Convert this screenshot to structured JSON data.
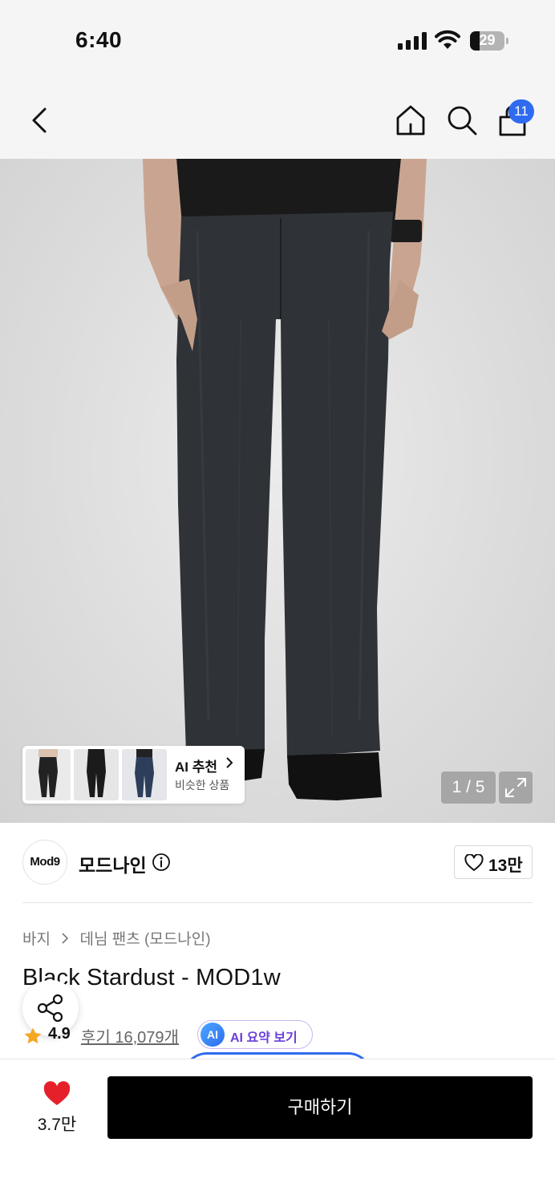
{
  "status_bar": {
    "time": "6:40",
    "battery": "29"
  },
  "nav": {
    "cart_badge": "11"
  },
  "hero": {
    "ai_recommend": {
      "title": "AI 추천",
      "subtitle": "비슷한 상품"
    },
    "page_indicator": "1 / 5"
  },
  "brand": {
    "logo_text": "Mod9",
    "name": "모드나인",
    "likes": "13만"
  },
  "product": {
    "breadcrumb": [
      "바지",
      "데님 팬츠 (모드나인)"
    ],
    "title": "Black Stardust - MOD1w",
    "rating": "4.9",
    "reviews": "후기 16,079개",
    "ai_summary": {
      "badge": "AI",
      "label": "AI 요약 보기"
    }
  },
  "bottom_bar": {
    "favorites": "3.7만",
    "buy_label": "구매하기"
  },
  "colors": {
    "accent_blue": "#2f6bf0",
    "heart_red": "#e5202b",
    "star_orange": "#f5a623",
    "ai_purple": "#6a3fd9"
  }
}
